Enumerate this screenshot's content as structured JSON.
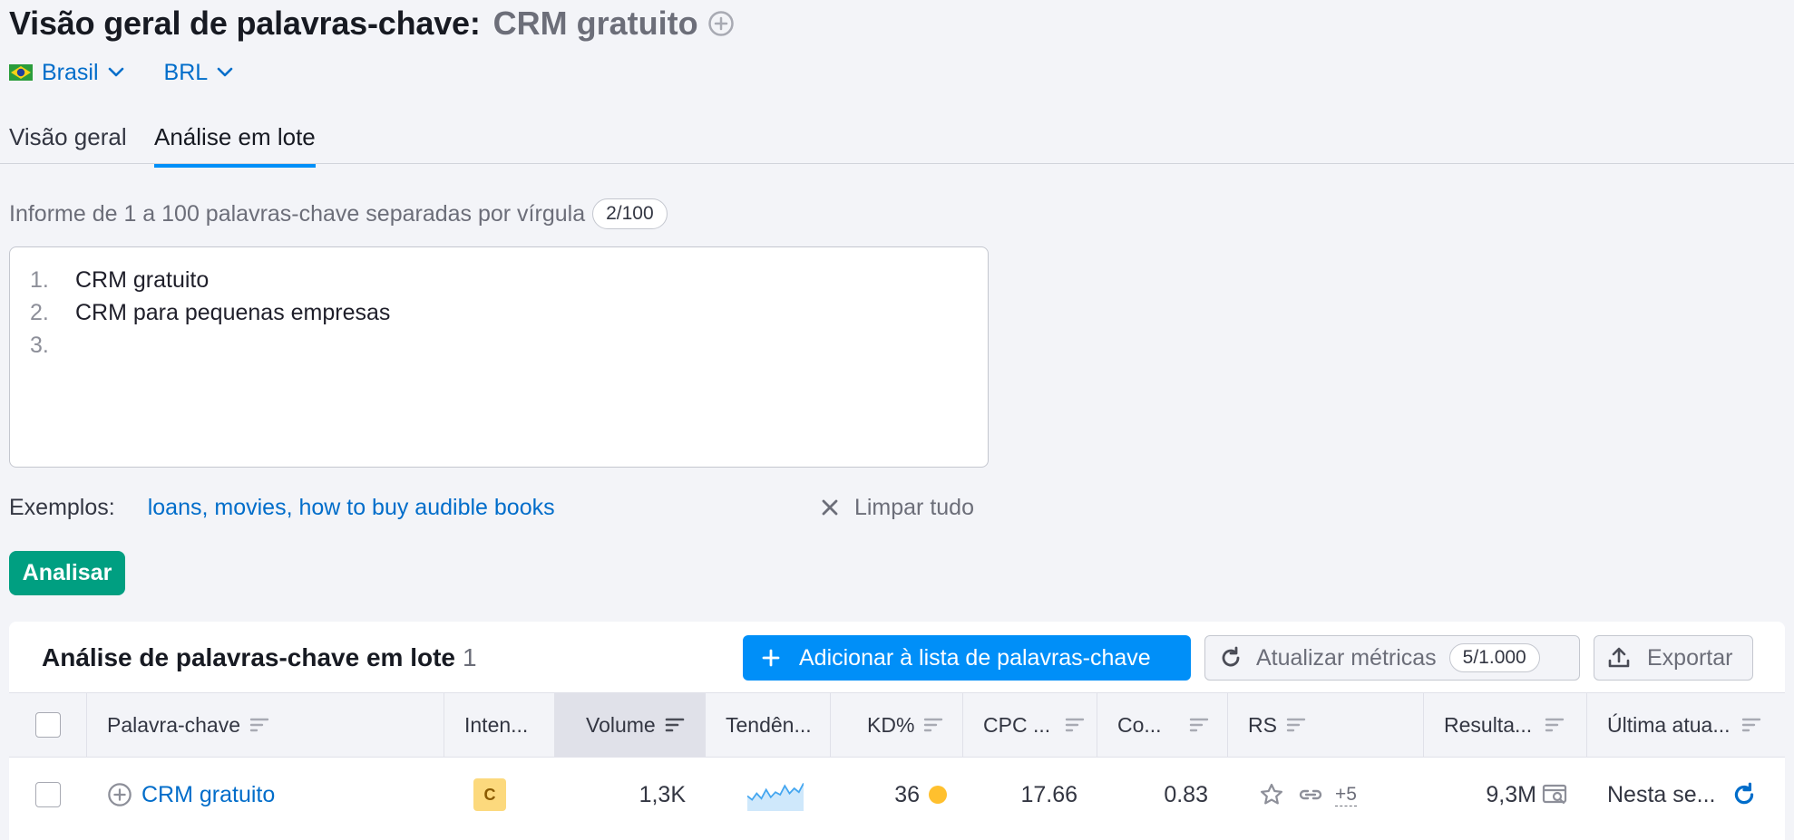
{
  "header": {
    "title": "Visão geral de palavras-chave:",
    "keyword": "CRM gratuito"
  },
  "selectors": {
    "country": "Brasil",
    "currency": "BRL"
  },
  "tabs": [
    {
      "label": "Visão geral"
    },
    {
      "label": "Análise em lote"
    }
  ],
  "input": {
    "hint": "Informe de 1 a 100 palavras-chave separadas por vírgula",
    "counter": "2/100",
    "lines": [
      {
        "num": "1.",
        "text": "CRM gratuito"
      },
      {
        "num": "2.",
        "text": "CRM para pequenas empresas"
      },
      {
        "num": "3.",
        "text": ""
      }
    ]
  },
  "examples": {
    "label": "Exemplos:",
    "link": "loans, movies, how to buy audible books",
    "clear": "Limpar tudo"
  },
  "analyze_label": "Analisar",
  "panel": {
    "title": "Análise de palavras-chave em lote",
    "count": "1",
    "add_label": "Adicionar à lista de palavras-chave",
    "update_label": "Atualizar métricas",
    "update_count": "5/1.000",
    "export_label": "Exportar"
  },
  "table": {
    "columns": {
      "keyword": "Palavra-chave",
      "intent": "Inten...",
      "volume": "Volume",
      "trend": "Tendên...",
      "kd": "KD%",
      "cpc": "CPC ...",
      "com": "Co...",
      "rs": "RS",
      "results": "Resulta...",
      "updated": "Última atua..."
    },
    "rows": [
      {
        "keyword": "CRM gratuito",
        "intent": "C",
        "volume": "1,3K",
        "trend": [
          0.45,
          0.3,
          0.55,
          0.35,
          0.7,
          0.4,
          0.6,
          0.5,
          0.85,
          0.55,
          0.75,
          0.6,
          0.95
        ],
        "kd": "36",
        "cpc": "17.66",
        "com": "0.83",
        "rs_more": "+5",
        "results": "9,3M",
        "updated": "Nesta se..."
      }
    ]
  },
  "colors": {
    "accent": "#008ff8",
    "link": "#006dca",
    "analyze": "#009f81",
    "intent_commercial": "#fcd97d",
    "kd_dot": "#ffc02e"
  }
}
